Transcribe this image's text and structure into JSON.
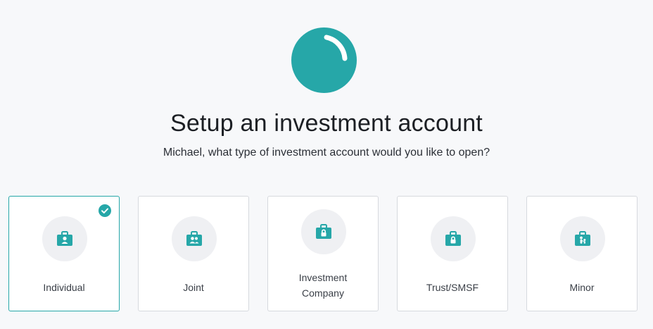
{
  "header": {
    "title": "Setup an investment account",
    "subtitle": "Michael, what type of investment account would you like to open?"
  },
  "colors": {
    "accent": "#26a7a8",
    "icon_bg": "#eff0f3",
    "card_border": "#d6d9de"
  },
  "account_types": [
    {
      "label": "Individual",
      "icon": "briefcase-person-icon",
      "selected": true
    },
    {
      "label": "Joint",
      "icon": "briefcase-people-icon",
      "selected": false
    },
    {
      "label_line1": "Investment",
      "label_line2": "Company",
      "icon": "briefcase-lock-icon",
      "selected": false
    },
    {
      "label": "Trust/SMSF",
      "icon": "briefcase-lock-icon",
      "selected": false
    },
    {
      "label": "Minor",
      "icon": "briefcase-family-icon",
      "selected": false
    }
  ]
}
